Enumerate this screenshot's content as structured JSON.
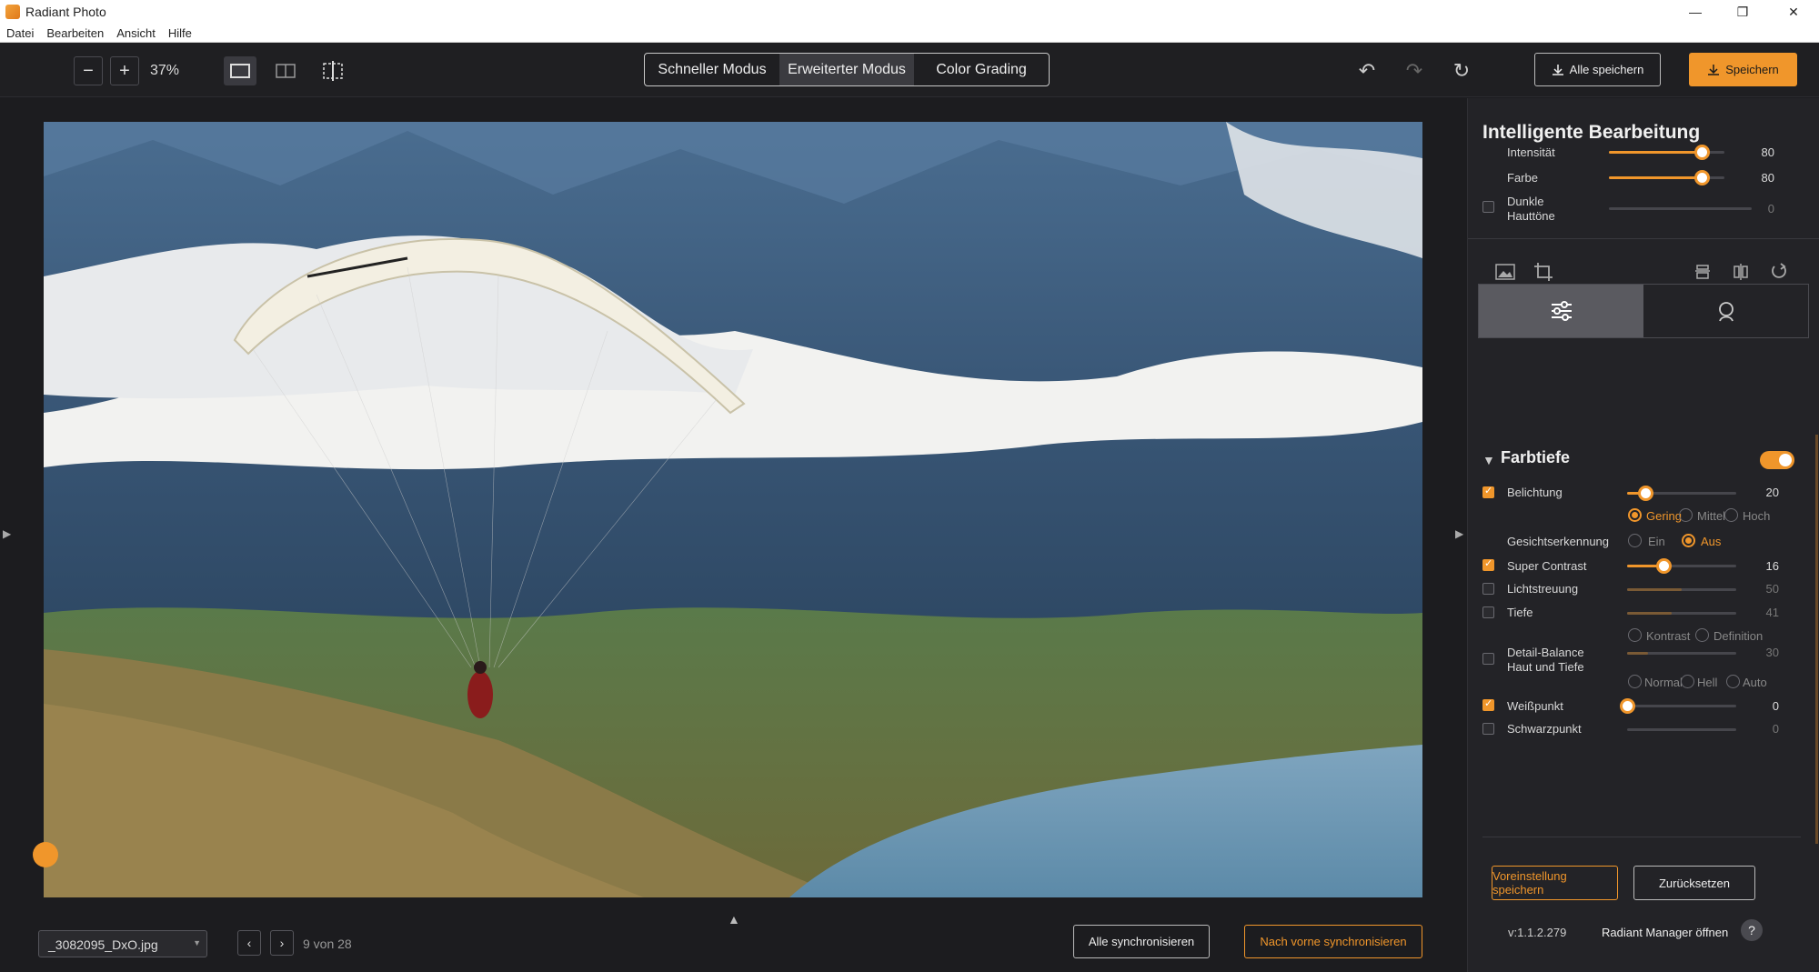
{
  "titlebar": {
    "title": "Radiant Photo",
    "minimize": "—",
    "maximize": "❐",
    "close": "✕"
  },
  "menu": [
    "Datei",
    "Bearbeiten",
    "Ansicht",
    "Hilfe"
  ],
  "toolbar": {
    "zoom_out": "−",
    "zoom_in": "+",
    "zoom": "37%",
    "modes": [
      "Schneller Modus",
      "Erweiterter Modus",
      "Color Grading"
    ],
    "active_mode": "Erweiterter Modus",
    "undo": "↶",
    "redo": "↷",
    "reset": "↻",
    "save_all": "Alle speichern",
    "save": "Speichern"
  },
  "bottom": {
    "file": "_3082095_DxO.jpg",
    "prev": "‹",
    "next": "›",
    "counter": "9 von 28",
    "sync_all": "Alle synchronisieren",
    "sync_forward": "Nach vorne synchronisieren"
  },
  "panel": {
    "title": "Intelligente Bearbeitung",
    "smart": [
      {
        "label": "Intensität",
        "value": "80",
        "level": 0.8
      },
      {
        "label": "Farbe",
        "value": "80",
        "level": 0.8
      },
      {
        "label": "Dunkle\nHauttöne",
        "value": "0",
        "level": 0.0
      }
    ],
    "section": "Farbtiefe",
    "rows": {
      "belichtung": {
        "label": "Belichtung",
        "value": "20",
        "level": 0.17
      },
      "belichtung_opts": [
        "Gering",
        "Mittel",
        "Hoch"
      ],
      "gesicht": {
        "label": "Gesichtserkennung",
        "opts": [
          "Ein",
          "Aus"
        ]
      },
      "contrast": {
        "label": "Super Contrast",
        "value": "16",
        "level": 0.33
      },
      "licht": {
        "label": "Lichtstreuung",
        "value": "50",
        "level": 0.5
      },
      "tiefe": {
        "label": "Tiefe",
        "value": "41",
        "level": 0.41
      },
      "tiefe_opts": [
        "Kontrast",
        "Definition"
      ],
      "detail": {
        "label": "Detail-Balance\nHaut und Tiefe",
        "value": "30",
        "level": 0.19
      },
      "detail_opts": [
        "Normal",
        "Hell",
        "Auto"
      ],
      "weiss": {
        "label": "Weißpunkt",
        "value": "0",
        "level": 0.0
      },
      "schwarz": {
        "label": "Schwarzpunkt",
        "value": "0",
        "level": 0.0
      }
    },
    "save_preset": "Voreinstellung speichern",
    "reset": "Zurücksetzen",
    "version": "v:1.1.2.279",
    "manager": "Radiant Manager öffnen",
    "help": "?"
  },
  "colors": {
    "accent": "#f0962b",
    "bg": "#1c1c1f",
    "panel": "#232327"
  }
}
